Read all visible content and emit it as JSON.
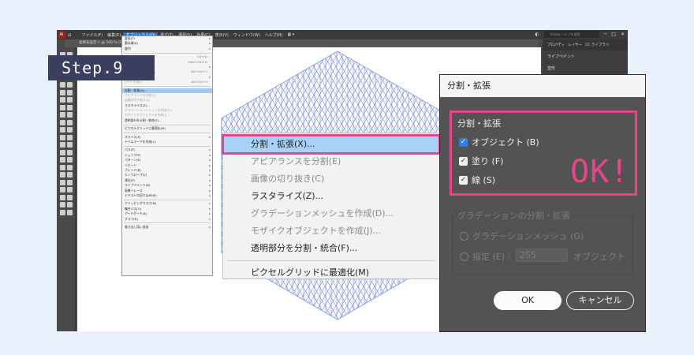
{
  "menubar": {
    "logo": "Ai",
    "items": [
      "ファイル(F)",
      "編集(E)",
      "オブジェクト(O)",
      "書式(T)",
      "選択(S)",
      "効果(C)",
      "表示(V)",
      "ウィンドウ(W)",
      "ヘルプ(H)"
    ],
    "search_placeholder": "Adobe ヘルプを検索"
  },
  "document_tab": "名称未設定-1 @ 500 % (CMYK/プレビュー)",
  "step_badge": "Step.9",
  "object_menu": {
    "rows": [
      {
        "label": "変形(T)",
        "arrow": true
      },
      {
        "label": "重ね順(A)",
        "arrow": true
      },
      {
        "label": "整列",
        "arrow": true
      },
      {
        "sep": true
      },
      {
        "label": "グループ",
        "shortcut": "Ctrl+G"
      },
      {
        "label": "グループ解除",
        "shortcut": "Shift+Ctrl+G",
        "disabled": true
      },
      {
        "label": "ロック(L)",
        "arrow": true
      },
      {
        "label": "すべてをロック解除(K)",
        "shortcut": "Alt+Ctrl+2",
        "disabled": true
      },
      {
        "label": "隠す(H)",
        "arrow": true
      },
      {
        "label": "すべてを表示",
        "shortcut": "Alt+Ctrl+3",
        "disabled": true
      },
      {
        "sep": true
      },
      {
        "label": "分割・拡張(X)...",
        "highlight": true
      },
      {
        "label": "アピアランスを分割(E)",
        "disabled": true
      },
      {
        "label": "画像の切り抜き(C)",
        "disabled": true
      },
      {
        "label": "ラスタライズ(Z)..."
      },
      {
        "label": "グラデーションメッシュを作成(D)...",
        "disabled": true
      },
      {
        "label": "モザイクオブジェクトを作成(J)...",
        "disabled": true
      },
      {
        "label": "透明部分を分割・統合(F)..."
      },
      {
        "sep": true
      },
      {
        "label": "ピクセルグリッドに最適化(M)"
      },
      {
        "sep": true
      },
      {
        "label": "スライス(S)",
        "arrow": true
      },
      {
        "label": "トリムマークを作成(C)"
      },
      {
        "sep": true
      },
      {
        "label": "パス(P)",
        "arrow": true
      },
      {
        "label": "シェイプ(P)",
        "arrow": true
      },
      {
        "label": "パターン(E)",
        "arrow": true
      },
      {
        "label": "リピート",
        "arrow": true
      },
      {
        "label": "ブレンド(B)",
        "arrow": true
      },
      {
        "label": "エンベロープ(V)",
        "arrow": true
      },
      {
        "label": "遠近(P)",
        "arrow": true
      },
      {
        "label": "ライブペイント(N)",
        "arrow": true
      },
      {
        "label": "画像トレース",
        "arrow": true
      },
      {
        "label": "テキストの回り込み(W)",
        "arrow": true
      },
      {
        "sep": true
      },
      {
        "label": "クリッピングマスク(M)",
        "arrow": true
      },
      {
        "label": "複合パス(O)",
        "arrow": true
      },
      {
        "label": "アートボード(A)",
        "arrow": true
      },
      {
        "label": "グラフ(R)",
        "arrow": true
      },
      {
        "sep": true
      },
      {
        "label": "書き出し用に追加",
        "arrow": true
      }
    ]
  },
  "zoom_menu": {
    "items": [
      {
        "label": "分割・拡張(X)...",
        "highlight": true
      },
      {
        "label": "アピアランスを分割(E)",
        "disabled": true
      },
      {
        "label": "画像の切り抜き(C)",
        "disabled": true
      },
      {
        "label": "ラスタライズ(Z)..."
      },
      {
        "label": "グラデーションメッシュを作成(D)...",
        "disabled": true
      },
      {
        "label": "モザイクオブジェクトを作成(J)...",
        "disabled": true
      },
      {
        "label": "透明部分を分割・統合(F)..."
      },
      {
        "sep": true
      },
      {
        "label": "ピクセルグリッドに最適化(M)"
      }
    ]
  },
  "panel": {
    "tabs": [
      "プロパティ",
      "レイヤー",
      "CC ライブラリ"
    ],
    "section": "ライブペイント",
    "sub": "変形"
  },
  "dialog": {
    "title": "分割・拡張",
    "group_expand": "分割・拡張",
    "check_object": "オブジェクト (B)",
    "check_fill": "塗り (F)",
    "check_stroke": "線 (S)",
    "group_gradient": "グラデーションの分割・拡張",
    "radio_mesh": "グラデーションメッシュ (G)",
    "radio_specify": "指定 (E) :",
    "specify_value": "255",
    "specify_unit": "オブジェクト",
    "ok": "OK",
    "cancel": "キャンセル"
  },
  "ok_annotation": "OK!"
}
